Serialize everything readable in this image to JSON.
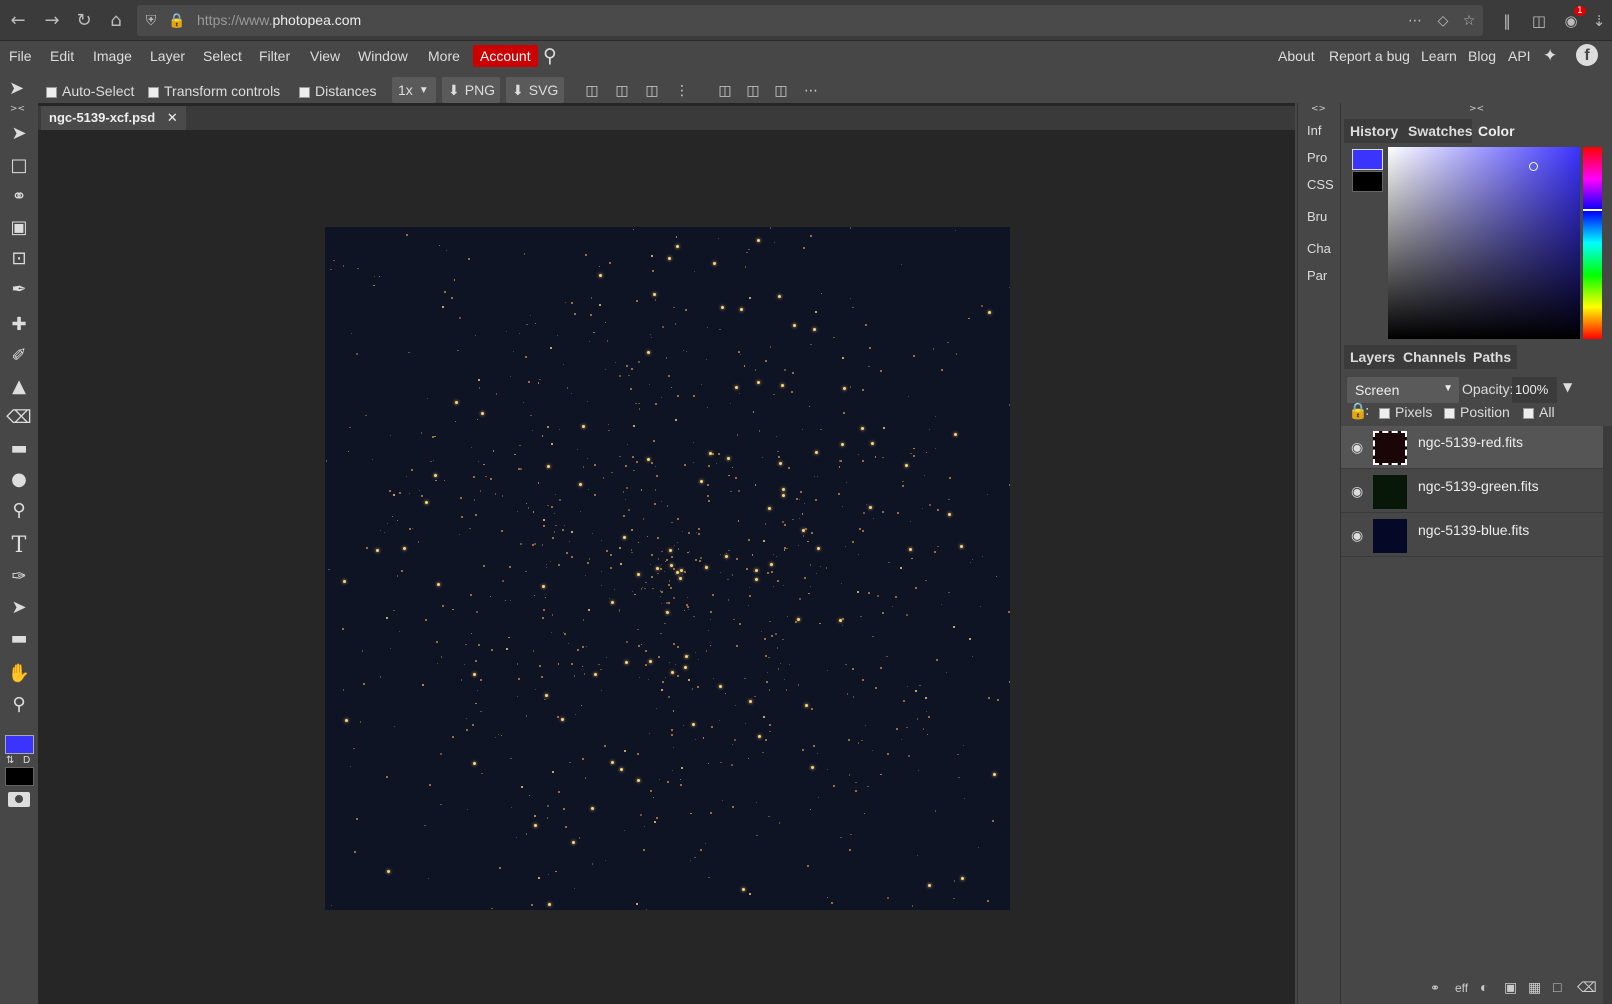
{
  "browser": {
    "url_prefix": "https://www.",
    "url_domain": "photopea.com",
    "notification_count": "1"
  },
  "menu": {
    "items": [
      "File",
      "Edit",
      "Image",
      "Layer",
      "Select",
      "Filter",
      "View",
      "Window",
      "More"
    ],
    "account": "Account",
    "right_items": [
      "About",
      "Report a bug",
      "Learn",
      "Blog",
      "API"
    ]
  },
  "options": {
    "auto_select": "Auto-Select",
    "transform_controls": "Transform controls",
    "distances": "Distances",
    "zoom": "1x",
    "png": "PNG",
    "svg": "SVG"
  },
  "document": {
    "tab_name": "ngc-5139-xcf.psd",
    "close": "✕"
  },
  "side_collapsed": [
    "Inf",
    "Pro",
    "CSS",
    "Bru",
    "Cha",
    "Par"
  ],
  "color_panel": {
    "tabs": [
      "History",
      "Swatches",
      "Color"
    ],
    "active_tab": "Color",
    "foreground": "#3b33ff",
    "background": "#000000"
  },
  "layers_panel": {
    "tabs": [
      "Layers",
      "Channels",
      "Paths"
    ],
    "blend_mode": "Screen",
    "opacity_label": "Opacity:",
    "opacity_value": "100%",
    "lock_colon": ":",
    "lock_options": [
      "Pixels",
      "Position",
      "All"
    ],
    "layers": [
      {
        "name": "ngc-5139-red.fits",
        "color": "#1a0606",
        "selected": true
      },
      {
        "name": "ngc-5139-green.fits",
        "color": "#081808",
        "selected": false
      },
      {
        "name": "ngc-5139-blue.fits",
        "color": "#060828",
        "selected": false
      }
    ],
    "bottom_eff": "eff"
  },
  "toolbar": {
    "swap": "⇅",
    "default": "D"
  }
}
